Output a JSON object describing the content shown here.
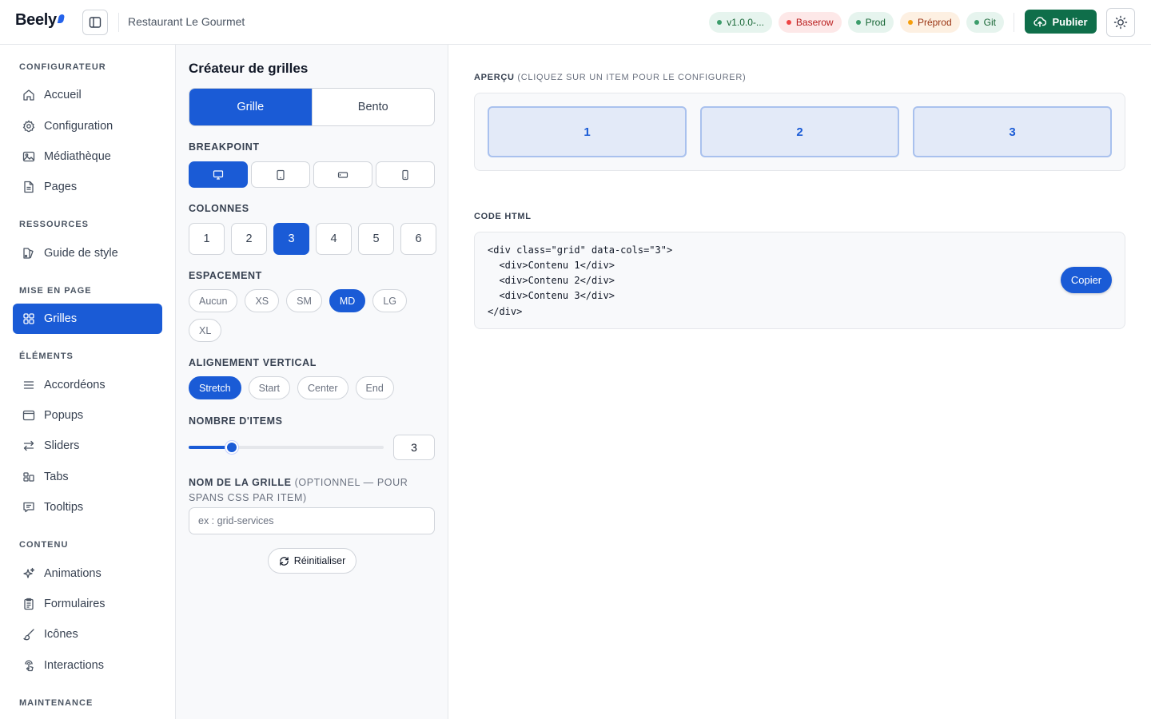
{
  "header": {
    "logo": "Beely",
    "site_name": "Restaurant Le Gourmet",
    "badges": [
      "v1.0.0-...",
      "Baserow",
      "Prod",
      "Préprod",
      "Git"
    ],
    "publish_label": "Publier"
  },
  "sidebar": {
    "sections": {
      "configurateur": "CONFIGURATEUR",
      "ressources": "RESSOURCES",
      "mise_en_page": "MISE EN PAGE",
      "elements": "ÉLÉMENTS",
      "contenu": "CONTENU",
      "maintenance": "MAINTENANCE"
    },
    "items": {
      "accueil": "Accueil",
      "configuration": "Configuration",
      "mediatheque": "Médiathèque",
      "pages": "Pages",
      "guide_style": "Guide de style",
      "grilles": "Grilles",
      "accordeons": "Accordéons",
      "popups": "Popups",
      "sliders": "Sliders",
      "tabs": "Tabs",
      "tooltips": "Tooltips",
      "animations": "Animations",
      "formulaires": "Formulaires",
      "icones": "Icônes",
      "interactions": "Interactions"
    },
    "active": "Grilles"
  },
  "panel": {
    "title": "Créateur de grilles",
    "modes": [
      "Grille",
      "Bento"
    ],
    "active_mode": "Grille",
    "breakpoint_label": "BREAKPOINT",
    "breakpoints": [
      "desktop-icon",
      "tablet-icon",
      "tablet-landscape-icon",
      "mobile-icon"
    ],
    "active_breakpoint": "desktop",
    "columns_label": "COLONNES",
    "columns": [
      "1",
      "2",
      "3",
      "4",
      "5",
      "6"
    ],
    "active_columns": "3",
    "spacing_label": "ESPACEMENT",
    "spacing": [
      "Aucun",
      "XS",
      "SM",
      "MD",
      "LG",
      "XL"
    ],
    "active_spacing": "MD",
    "align_label": "ALIGNEMENT VERTICAL",
    "align": [
      "Stretch",
      "Start",
      "Center",
      "End"
    ],
    "active_align": "Stretch",
    "items_label": "NOMBRE D'ITEMS",
    "items_count": "3",
    "items_slider_fraction": 0.2,
    "grid_name_label": "NOM DE LA GRILLE",
    "grid_name_hint": "(OPTIONNEL — POUR SPANS CSS PAR ITEM)",
    "grid_name_placeholder": "ex : grid-services",
    "reset_label": "Réinitialiser"
  },
  "main": {
    "preview_label": "APERÇU",
    "preview_hint": "(CLIQUEZ SUR UN ITEM POUR LE CONFIGURER)",
    "preview_items": [
      "1",
      "2",
      "3"
    ],
    "code_label": "CODE HTML",
    "code_lines": [
      "<div class=\"grid\" data-cols=\"3\">",
      "  <div>Contenu 1</div>",
      "  <div>Contenu 2</div>",
      "  <div>Contenu 3</div>",
      "</div>"
    ],
    "copy_label": "Copier"
  },
  "colors": {
    "accent": "#1a5bd6",
    "publish": "#0f6e4a"
  }
}
